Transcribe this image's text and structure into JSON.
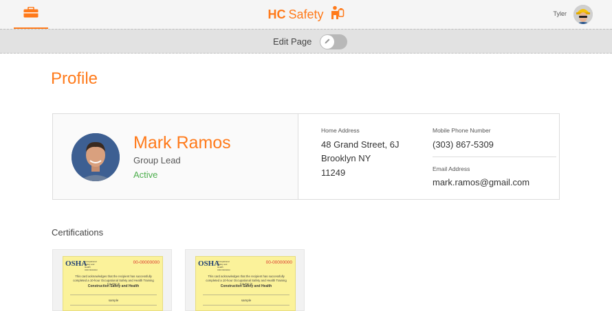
{
  "header": {
    "brand_bold": "HC",
    "brand_text": "Safety",
    "user_name": "Tyler",
    "toolbox_icon": "toolbox-icon",
    "logo_icon": "worker-logo-icon"
  },
  "editbar": {
    "label": "Edit Page",
    "toggle_on": false,
    "toggle_icon": "pencil-icon"
  },
  "page": {
    "title": "Profile"
  },
  "profile": {
    "name": "Mark Ramos",
    "role": "Group Lead",
    "status": "Active",
    "home_address_label": "Home Address",
    "address_line1": "48 Grand Street, 6J",
    "address_line2": "Brooklyn NY",
    "address_line3": "11249",
    "mobile_label": "Mobile Phone Number",
    "mobile": "(303) 867-5309",
    "email_label": "Email Address",
    "email": "mark.ramos@gmail.com"
  },
  "certifications": {
    "heading": "Certifications",
    "cards": [
      {
        "logo": "OSHA",
        "org": "Occupational Safety and Health Administration",
        "number": "00-00000000",
        "text": "This card acknowledges that the recipient has successfully completed a 10-hour Occupational Safety and Health Training Course in",
        "course": "Construction Safety and Health",
        "name": "sample"
      },
      {
        "logo": "OSHA",
        "org": "Occupational Safety and Health Administration",
        "number": "00-00000000",
        "text": "This card acknowledges that the recipient has successfully completed a 10-hour Occupational Safety and Health Training Course in",
        "course": "Construction Safety and Health",
        "name": "sample"
      }
    ]
  },
  "colors": {
    "accent": "#ff7a1a",
    "status_active": "#4cae4c",
    "card_yellow": "#fbf29a"
  }
}
